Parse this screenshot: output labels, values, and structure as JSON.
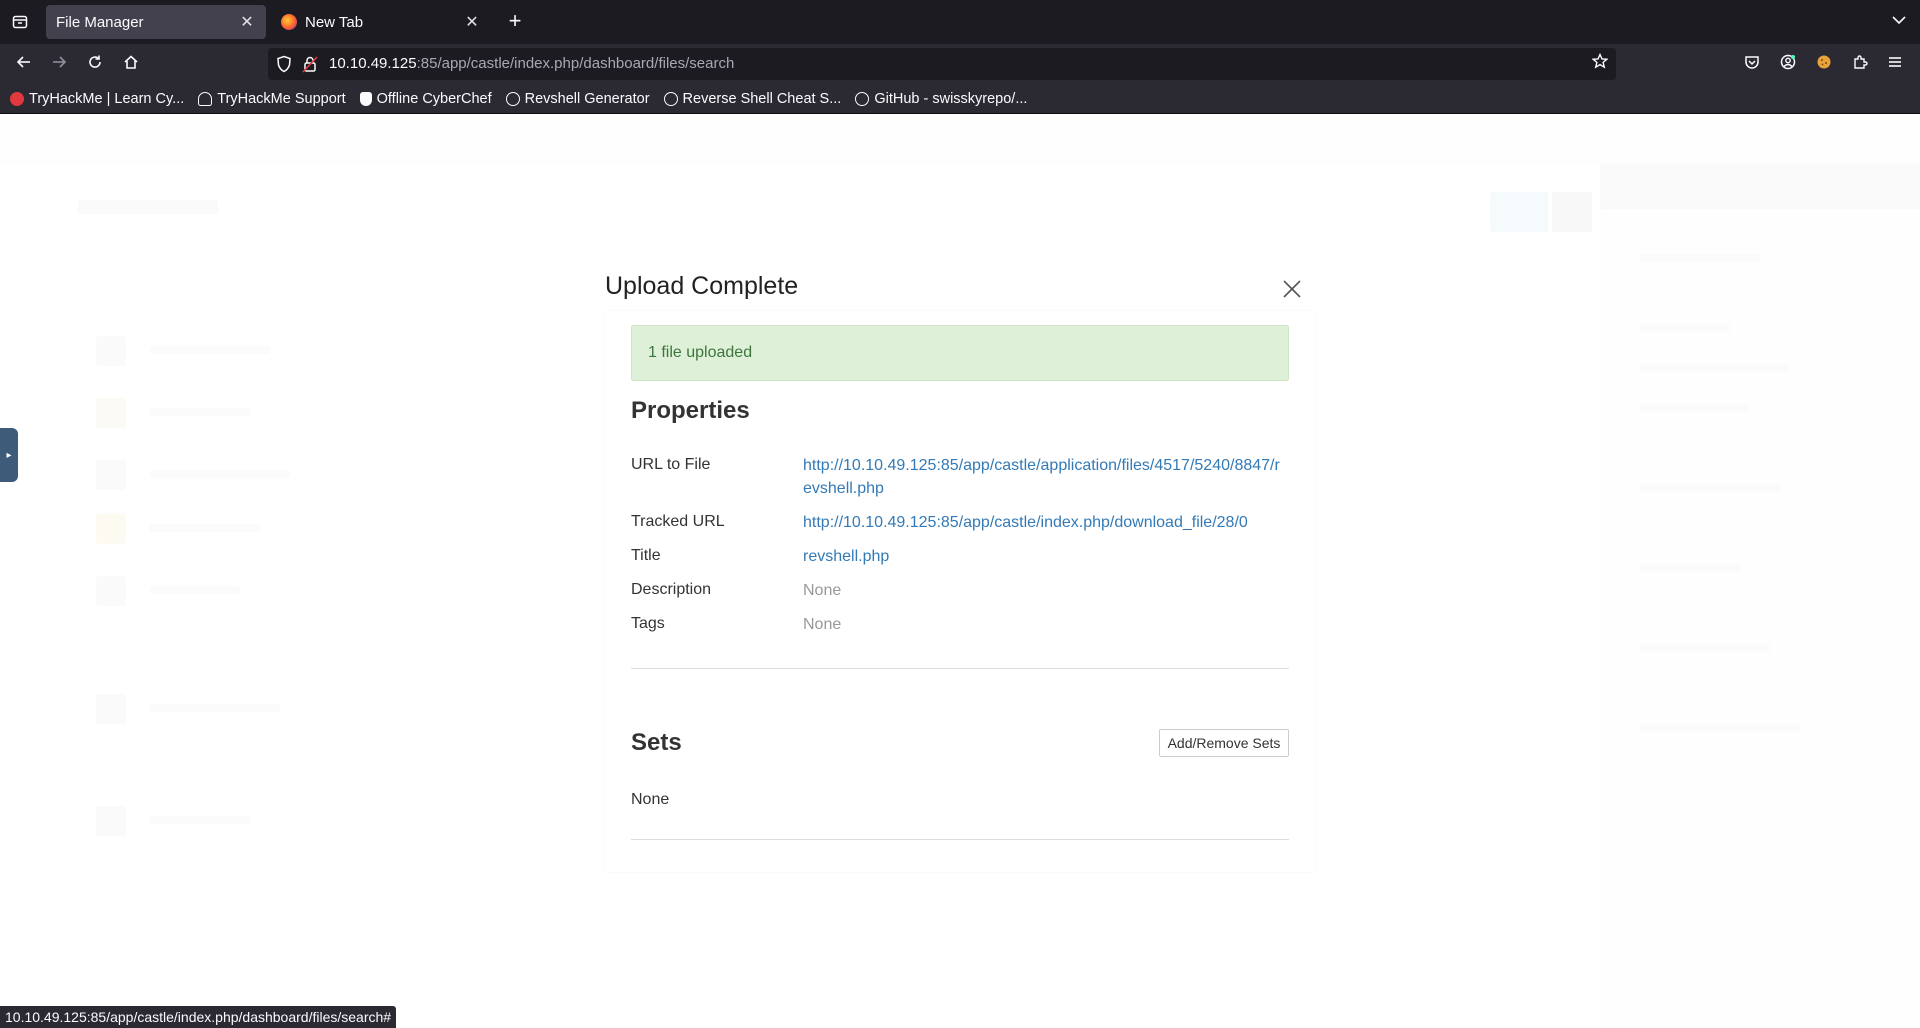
{
  "browser": {
    "tabs": [
      {
        "title": "File Manager",
        "active": true
      },
      {
        "title": "New Tab",
        "active": false
      }
    ],
    "url": {
      "host": "10.10.49.125",
      "rest": ":85/app/castle/index.php/dashboard/files/search"
    },
    "bookmarks": [
      {
        "label": "TryHackMe | Learn Cy...",
        "icon": "tryhackme-icon"
      },
      {
        "label": "TryHackMe Support",
        "icon": "cloud-icon"
      },
      {
        "label": "Offline CyberChef",
        "icon": "chef-hat-icon"
      },
      {
        "label": "Revshell Generator",
        "icon": "globe-icon"
      },
      {
        "label": "Reverse Shell Cheat S...",
        "icon": "globe-icon"
      },
      {
        "label": "GitHub - swisskyrepo/...",
        "icon": "github-icon"
      }
    ],
    "status_url": "10.10.49.125:85/app/castle/index.php/dashboard/files/search#"
  },
  "modal": {
    "title": "Upload Complete",
    "alert": "1 file uploaded",
    "properties_heading": "Properties",
    "properties": {
      "url_label": "URL to File",
      "url_value": "http://10.10.49.125:85/app/castle/application/files/4517/5240/8847/revshell.php",
      "tracked_label": "Tracked URL",
      "tracked_value": "http://10.10.49.125:85/app/castle/index.php/download_file/28/0",
      "title_label": "Title",
      "title_value": "revshell.php",
      "description_label": "Description",
      "description_value": "None",
      "tags_label": "Tags",
      "tags_value": "None"
    },
    "sets_heading": "Sets",
    "sets_button": "Add/Remove Sets",
    "sets_value": "None"
  },
  "colors": {
    "link": "#337ab7",
    "success_bg": "#dff0d8",
    "success_text": "#3c763d",
    "chrome_dark": "#1c1b22",
    "chrome_toolbar": "#2b2a33"
  }
}
